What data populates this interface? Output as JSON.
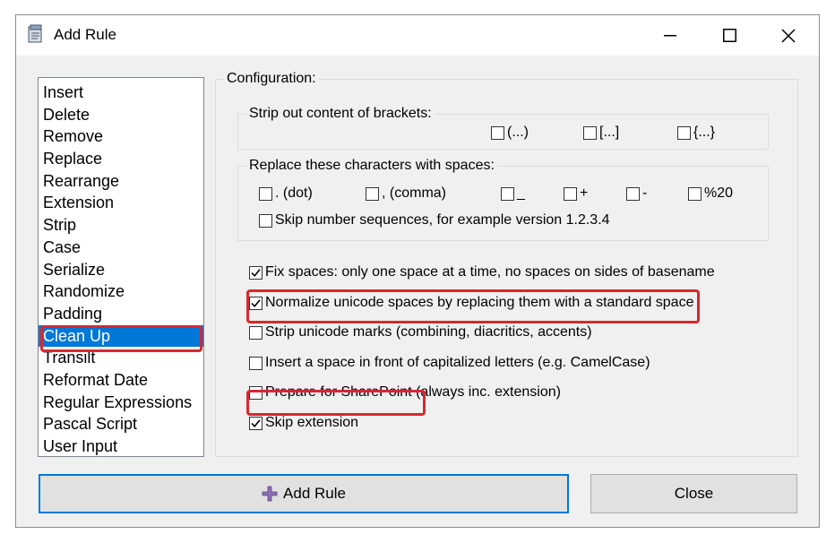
{
  "window": {
    "title": "Add Rule",
    "controls": {
      "minimize": "minimize",
      "maximize": "maximize",
      "close": "close"
    }
  },
  "rule_list": {
    "items": [
      "Insert",
      "Delete",
      "Remove",
      "Replace",
      "Rearrange",
      "Extension",
      "Strip",
      "Case",
      "Serialize",
      "Randomize",
      "Padding",
      "Clean Up",
      "Transilt",
      "Reformat Date",
      "Regular Expressions",
      "Pascal Script",
      "User Input"
    ],
    "selected": "Clean Up"
  },
  "configuration": {
    "label": "Configuration:",
    "brackets": {
      "label": "Strip out content of brackets:",
      "options": [
        {
          "label": "(...)",
          "checked": false
        },
        {
          "label": "[...]",
          "checked": false
        },
        {
          "label": "{...}",
          "checked": false
        }
      ]
    },
    "replace_chars": {
      "label": "Replace these characters with spaces:",
      "options": [
        {
          "label": ". (dot)",
          "checked": false
        },
        {
          "label": ", (comma)",
          "checked": false
        },
        {
          "label": "_",
          "checked": false
        },
        {
          "label": "+",
          "checked": false
        },
        {
          "label": "-",
          "checked": false
        },
        {
          "label": "%20",
          "checked": false
        }
      ],
      "skip_numbers": {
        "label": "Skip number sequences, for example version 1.2.3.4",
        "checked": false
      }
    },
    "options": [
      {
        "label": "Fix spaces: only one space at a time, no spaces on sides of basename",
        "checked": true
      },
      {
        "label": "Normalize unicode spaces by replacing them with a standard space",
        "checked": true
      },
      {
        "label": "Strip unicode marks (combining, diacritics, accents)",
        "checked": false
      },
      {
        "label": "Insert a space in front of capitalized letters (e.g. CamelCase)",
        "checked": false
      },
      {
        "label": "Prepare for SharePoint (always inc. extension)",
        "checked": false
      },
      {
        "label": "Skip extension",
        "checked": true
      }
    ]
  },
  "buttons": {
    "add_rule": "Add Rule",
    "close": "Close"
  },
  "colors": {
    "selection": "#0078d7",
    "annotation": "#d7282e",
    "default_button_border": "#0078d7"
  }
}
